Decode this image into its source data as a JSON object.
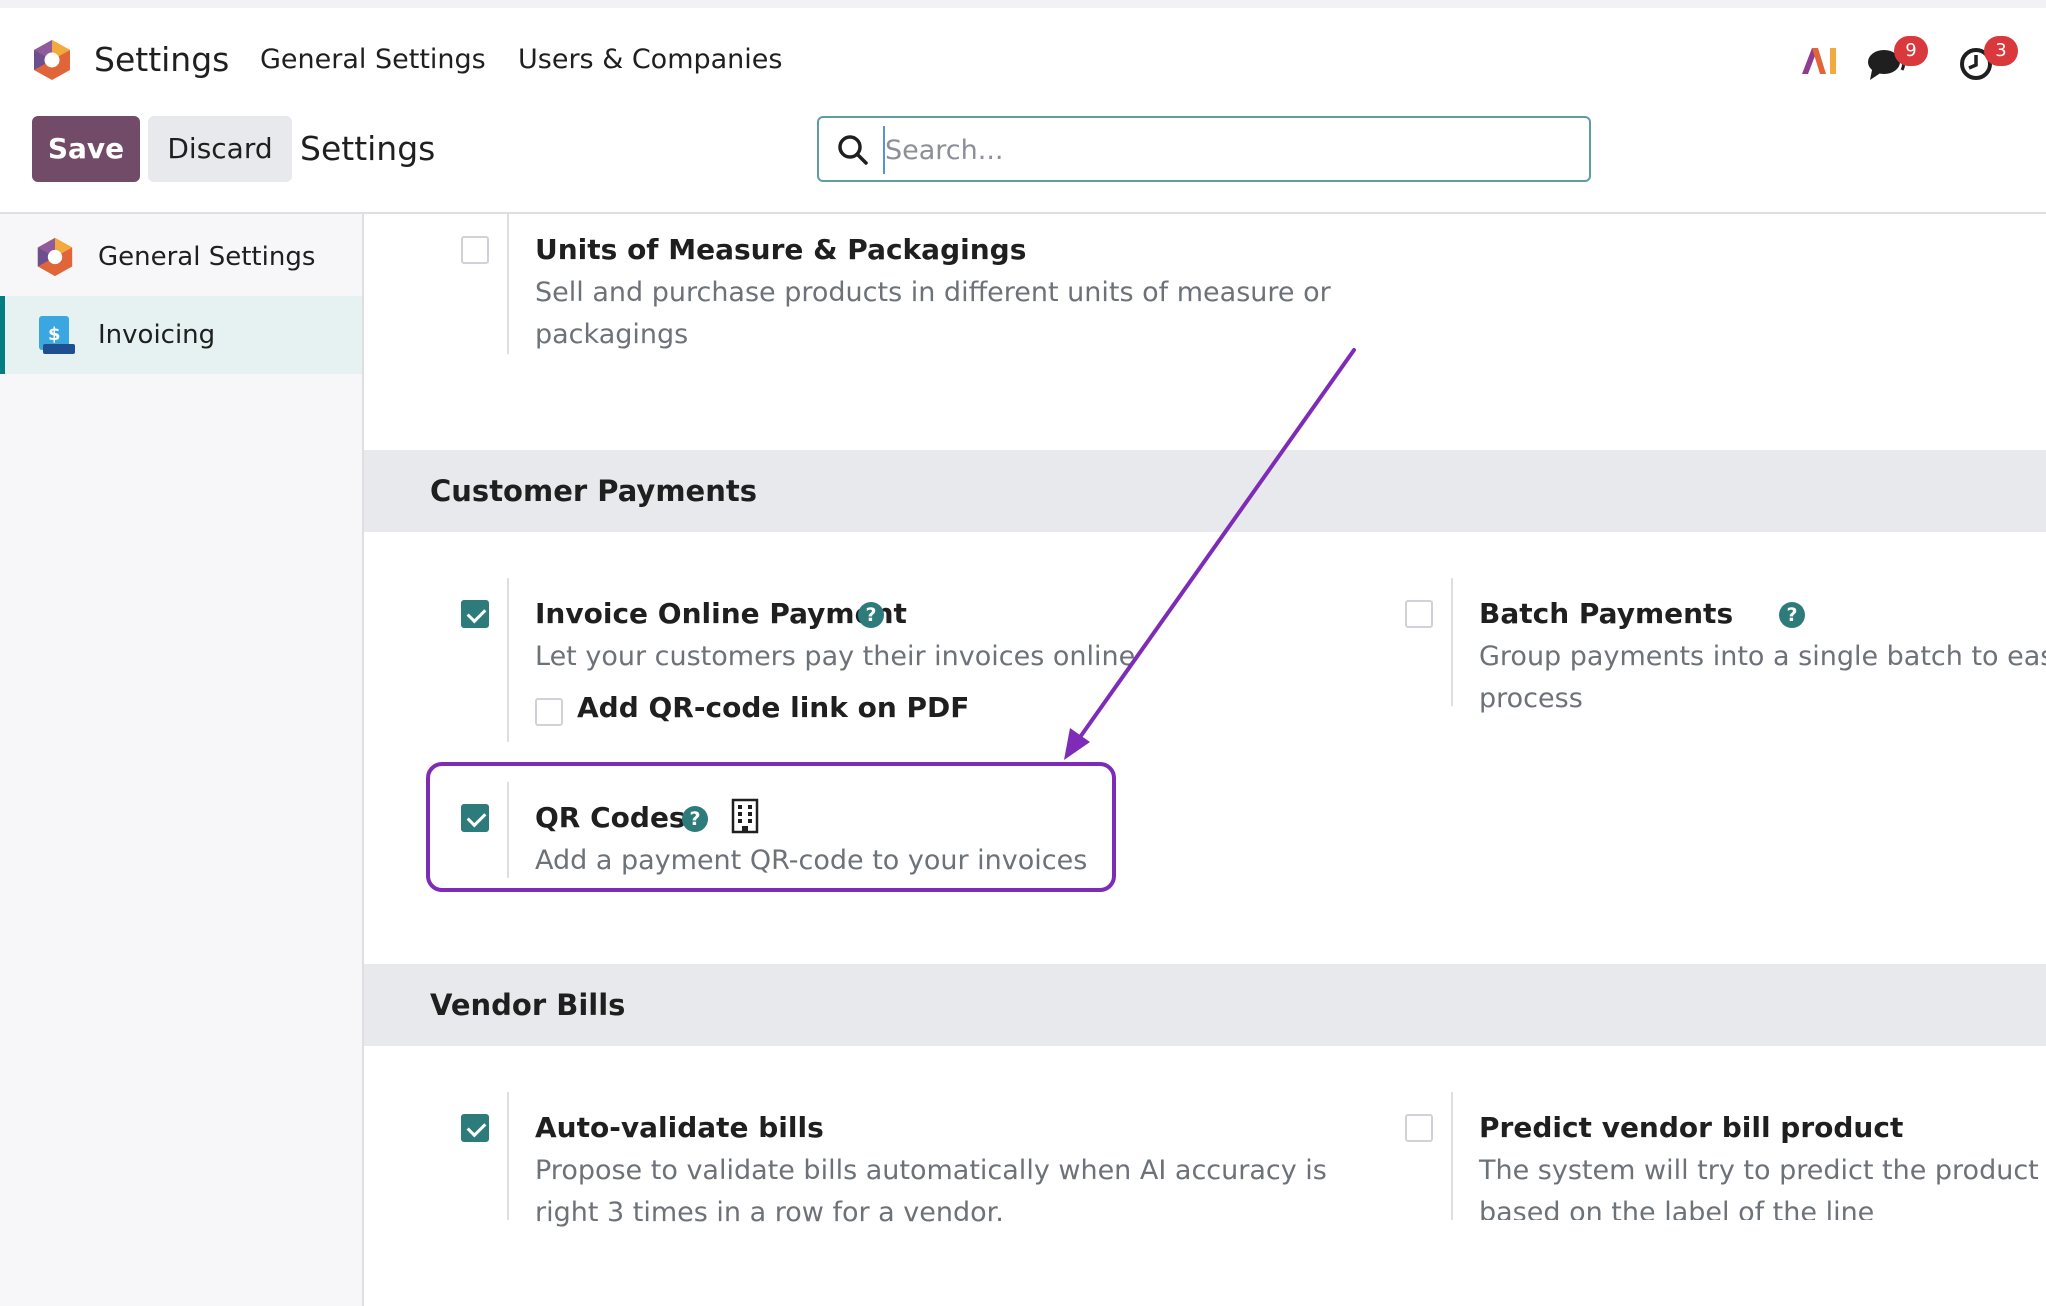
{
  "navbar": {
    "app_name": "Settings",
    "menus": [
      "General Settings",
      "Users & Companies"
    ],
    "ai_label": "AI",
    "messages_count": "9",
    "activities_count": "3",
    "colors": {
      "badge": "#d9383c",
      "brand": "#714b67"
    }
  },
  "control_panel": {
    "save_label": "Save",
    "discard_label": "Discard",
    "breadcrumb": "Settings",
    "search_placeholder": "Search..."
  },
  "sidebar": {
    "items": [
      {
        "label": "General Settings",
        "icon": "odoo-logo-icon",
        "active": false
      },
      {
        "label": "Invoicing",
        "icon": "invoicing-icon",
        "active": true
      }
    ]
  },
  "settings": {
    "uom": {
      "title": "Units of Measure & Packagings",
      "desc_line1": "Sell and purchase products in different units of measure or",
      "desc_line2": "packagings",
      "checked": false
    },
    "customer_payments": {
      "heading": "Customer Payments",
      "online_payment": {
        "title": "Invoice Online Payment",
        "desc": "Let your customers pay their invoices online",
        "checked": true,
        "sub_option": {
          "label": "Add QR-code link on PDF",
          "checked": false
        }
      },
      "batch_payments": {
        "title": "Batch Payments",
        "desc_line1": "Group payments into a single batch to ease",
        "desc_line2": "process",
        "checked": false
      },
      "qr_codes": {
        "title": "QR Codes",
        "desc": "Add a payment QR-code to your invoices",
        "checked": true
      }
    },
    "vendor_bills": {
      "heading": "Vendor Bills",
      "auto_validate": {
        "title": "Auto-validate bills",
        "desc_line1": "Propose to validate bills automatically when AI accuracy is",
        "desc_line2": "right 3 times in a row for a vendor.",
        "checked": true
      },
      "predict_product": {
        "title": "Predict vendor bill product",
        "desc_line1": "The system will try to predict the product on",
        "desc_line2": "based on the label of the line",
        "checked": false
      }
    }
  },
  "annotation": {
    "color": "#7e2bb8"
  }
}
